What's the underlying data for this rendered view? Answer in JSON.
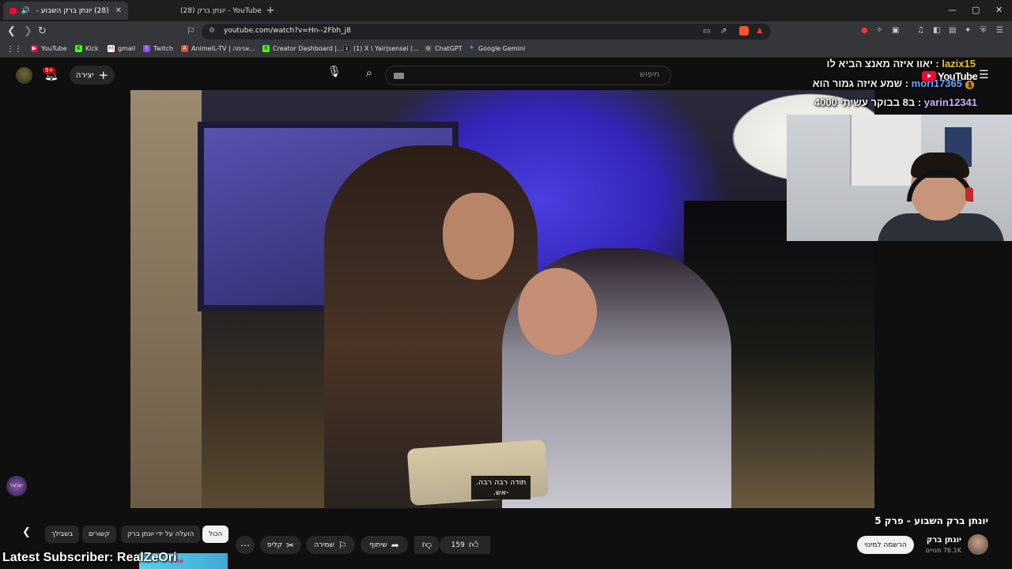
{
  "browser": {
    "tabs": [
      {
        "label": "(28) יונתן ברק השבוע - פרק 5",
        "active": true
      },
      {
        "label": "(28) יונתן ברק - YouTube",
        "active": false
      }
    ],
    "new_tab": "+",
    "window_controls": {
      "minimize": "—",
      "maximize": "▢",
      "close": "✕"
    },
    "url": "youtube.com/watch?v=Hn--2Fbh_j8",
    "bookmarks": [
      {
        "label": "YouTube",
        "icon": "youtube-icon",
        "color": "#ff0033"
      },
      {
        "label": "Kick",
        "icon": "kick-icon",
        "color": "#53fc18"
      },
      {
        "label": "gmail",
        "icon": "gmail-icon",
        "color": "#ea4335"
      },
      {
        "label": "Twitch",
        "icon": "twitch-icon",
        "color": "#9146ff"
      },
      {
        "label": "AnimelL-TV | אנימה...",
        "icon": "anime-icon",
        "color": "#d24b3a"
      },
      {
        "label": "Creator Dashboard |...",
        "icon": "kick-icon",
        "color": "#53fc18"
      },
      {
        "label": "(1) X \\ Yair|sensei (...",
        "icon": "x-icon",
        "color": "#000000"
      },
      {
        "label": "ChatGPT",
        "icon": "chatgpt-icon",
        "color": "#cccccc"
      },
      {
        "label": "Google Gemini",
        "icon": "gemini-icon",
        "color": "#4c8df6"
      }
    ]
  },
  "youtube": {
    "search_placeholder": "חיפוש",
    "create_label": "יצירה",
    "notifications_badge": "9+",
    "logo_text": "YouTube",
    "video": {
      "subtitle_line1": "תודה רבה רבה.",
      "subtitle_line2": "-אש."
    },
    "title": "יונתן ברק השבוע - פרק 5",
    "channel": {
      "name": "יונתן ברק",
      "subscribers": "76.1K מנויים",
      "subscribe_label": "הרשמה למינוי"
    },
    "actions": {
      "likes": "159",
      "share": "שיתוף",
      "save": "שמירה",
      "clip": "קליפ"
    },
    "chips": [
      {
        "label": "הכול",
        "active": true
      },
      {
        "label": "הועלה על ידי יונתן ברק",
        "active": false
      },
      {
        "label": "קשורים",
        "active": false
      },
      {
        "label": "בשבילך",
        "active": false
      }
    ]
  },
  "stream_overlay": {
    "chat": [
      {
        "user": "lazix15",
        "message": "יאוו איזה מאנצ הביא לו"
      },
      {
        "user": "mori17365",
        "message": "שמע איזה גמור הוא",
        "tier": "1"
      },
      {
        "user": "yarin12341",
        "message": "ב8 בבוקר עשיתי 4000"
      }
    ],
    "latest_subscriber": "Latest Subscriber: RealZeOri",
    "small_logo_text": "ישראל",
    "strip_text": "ערוץ"
  }
}
